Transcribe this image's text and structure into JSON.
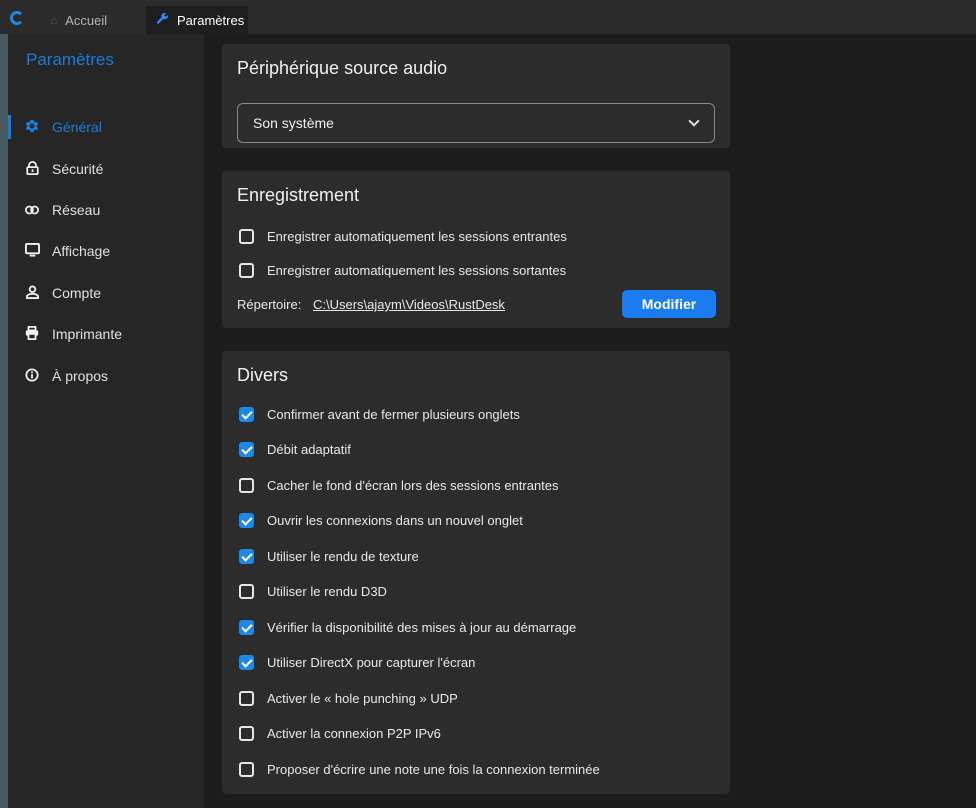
{
  "tabs": [
    {
      "label": "Accueil",
      "icon": "home-icon"
    },
    {
      "label": "Paramètres",
      "icon": "wrench-icon"
    }
  ],
  "sidebar": {
    "title": "Paramètres",
    "items": [
      {
        "label": "Général",
        "icon": "gear-icon",
        "active": true
      },
      {
        "label": "Sécurité",
        "icon": "lock-icon"
      },
      {
        "label": "Réseau",
        "icon": "link-icon"
      },
      {
        "label": "Affichage",
        "icon": "monitor-icon"
      },
      {
        "label": "Compte",
        "icon": "user-icon"
      },
      {
        "label": "Imprimante",
        "icon": "printer-icon"
      },
      {
        "label": "À propos",
        "icon": "info-icon"
      }
    ]
  },
  "audio": {
    "title": "Périphérique source audio",
    "selected": "Son système"
  },
  "recording": {
    "title": "Enregistrement",
    "options": [
      {
        "label": "Enregistrer automatiquement les sessions entrantes",
        "checked": false
      },
      {
        "label": "Enregistrer automatiquement les sessions sortantes",
        "checked": false
      }
    ],
    "dir_label": "Répertoire:",
    "dir_path": "C:\\Users\\ajaym\\Videos\\RustDesk",
    "modify_label": "Modifier"
  },
  "misc": {
    "title": "Divers",
    "options": [
      {
        "label": "Confirmer avant de fermer plusieurs onglets",
        "checked": true
      },
      {
        "label": "Débit adaptatif",
        "checked": true
      },
      {
        "label": "Cacher le fond d'écran lors des sessions entrantes",
        "checked": false
      },
      {
        "label": "Ouvrir les connexions dans un nouvel onglet",
        "checked": true
      },
      {
        "label": "Utiliser le rendu de texture",
        "checked": true
      },
      {
        "label": "Utiliser le rendu D3D",
        "checked": false
      },
      {
        "label": "Vérifier la disponibilité des mises à jour au démarrage",
        "checked": true
      },
      {
        "label": "Utiliser DirectX pour capturer l'écran",
        "checked": true
      },
      {
        "label": "Activer le « hole punching » UDP",
        "checked": false
      },
      {
        "label": "Activer la connexion P2P IPv6",
        "checked": false
      },
      {
        "label": "Proposer d'écrire une note une fois la connexion terminée",
        "checked": false
      }
    ]
  },
  "colors": {
    "accent": "#1a7cd6",
    "button": "#1a7cf0",
    "card": "#2c2c2c",
    "sidebar": "#262626"
  }
}
